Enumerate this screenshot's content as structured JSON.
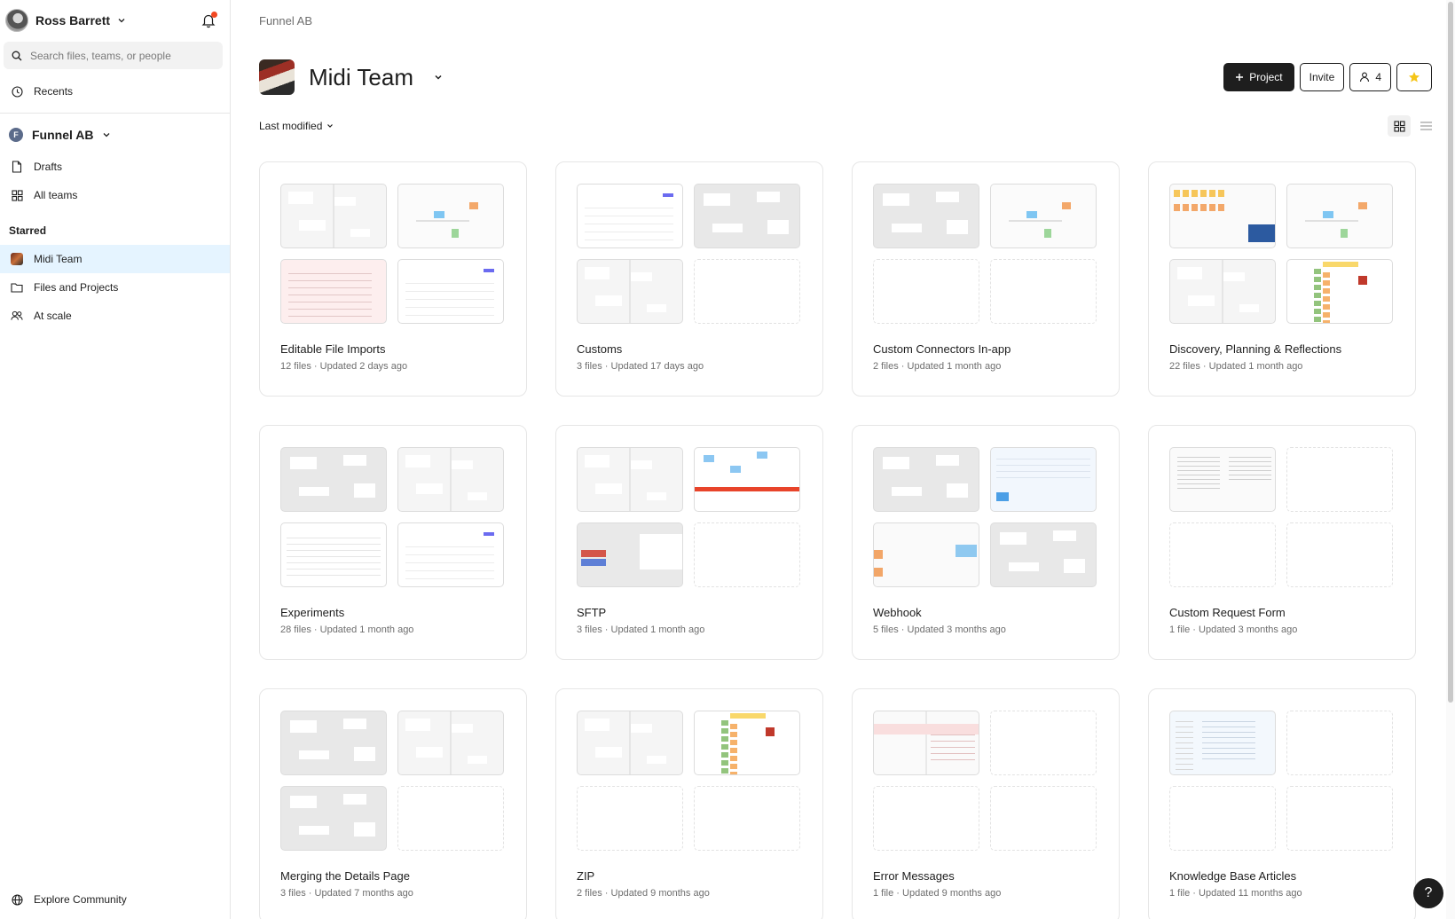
{
  "user": {
    "name": "Ross Barrett"
  },
  "search": {
    "placeholder": "Search files, teams, or people"
  },
  "nav": {
    "recents": "Recents"
  },
  "org": {
    "badge": "F",
    "name": "Funnel AB",
    "drafts": "Drafts",
    "all_teams": "All teams"
  },
  "starred": {
    "label": "Starred",
    "items": [
      {
        "label": "Midi Team",
        "icon": "team-thumbnail",
        "active": true
      },
      {
        "label": "Files and Projects",
        "icon": "folder-icon"
      },
      {
        "label": "At scale",
        "icon": "people-icon"
      }
    ]
  },
  "footer": {
    "explore": "Explore Community"
  },
  "header": {
    "breadcrumb": "Funnel AB",
    "title": "Midi Team",
    "project_button": "Project",
    "invite_button": "Invite",
    "members_count": "4",
    "sort_label": "Last modified"
  },
  "projects": [
    {
      "name": "Editable File Imports",
      "meta": "12 files · Updated 2 days ago",
      "thumbs": [
        "t-grid",
        "t-mixed",
        "t-pink",
        "t-table"
      ]
    },
    {
      "name": "Customs",
      "meta": "3 files · Updated 17 days ago",
      "thumbs": [
        "t-table",
        "t-gray",
        "t-grid",
        "empty"
      ]
    },
    {
      "name": "Custom Connectors In-app",
      "meta": "2 files · Updated 1 month ago",
      "thumbs": [
        "t-gray",
        "t-mixed",
        "empty",
        "empty"
      ]
    },
    {
      "name": "Discovery, Planning & Reflections",
      "meta": "22 files · Updated 1 month ago",
      "thumbs": [
        "t-sticky",
        "t-mixed",
        "t-grid",
        "t-colorful"
      ]
    },
    {
      "name": "Experiments",
      "meta": "28 files · Updated 1 month ago",
      "thumbs": [
        "t-gray",
        "t-grid",
        "t-doc",
        "t-table"
      ]
    },
    {
      "name": "SFTP",
      "meta": "3 files · Updated 1 month ago",
      "thumbs": [
        "t-grid",
        "t-redbar",
        "t-chart",
        "empty"
      ]
    },
    {
      "name": "Webhook",
      "meta": "5 files · Updated 3 months ago",
      "thumbs": [
        "t-gray",
        "t-blue",
        "t-orange",
        "t-gray"
      ]
    },
    {
      "name": "Custom Request Form",
      "meta": "1 file · Updated 3 months ago",
      "thumbs": [
        "t-textcols",
        "empty",
        "empty",
        "empty"
      ]
    },
    {
      "name": "Merging the Details Page",
      "meta": "3 files · Updated 7 months ago",
      "thumbs": [
        "t-gray",
        "t-grid",
        "t-gray",
        "empty"
      ]
    },
    {
      "name": "ZIP",
      "meta": "2 files · Updated 9 months ago",
      "thumbs": [
        "t-grid",
        "t-colorful",
        "empty",
        "empty"
      ]
    },
    {
      "name": "Error Messages",
      "meta": "1 file · Updated 9 months ago",
      "thumbs": [
        "t-errors",
        "empty",
        "empty",
        "empty"
      ]
    },
    {
      "name": "Knowledge Base Articles",
      "meta": "1 file · Updated 11 months ago",
      "thumbs": [
        "t-kb",
        "empty",
        "empty",
        "empty"
      ]
    }
  ],
  "colors": {
    "accent_active_bg": "#e5f4ff",
    "primary_button": "#1e1e1e",
    "star": "#f5c518",
    "notification_dot": "#f24822"
  }
}
